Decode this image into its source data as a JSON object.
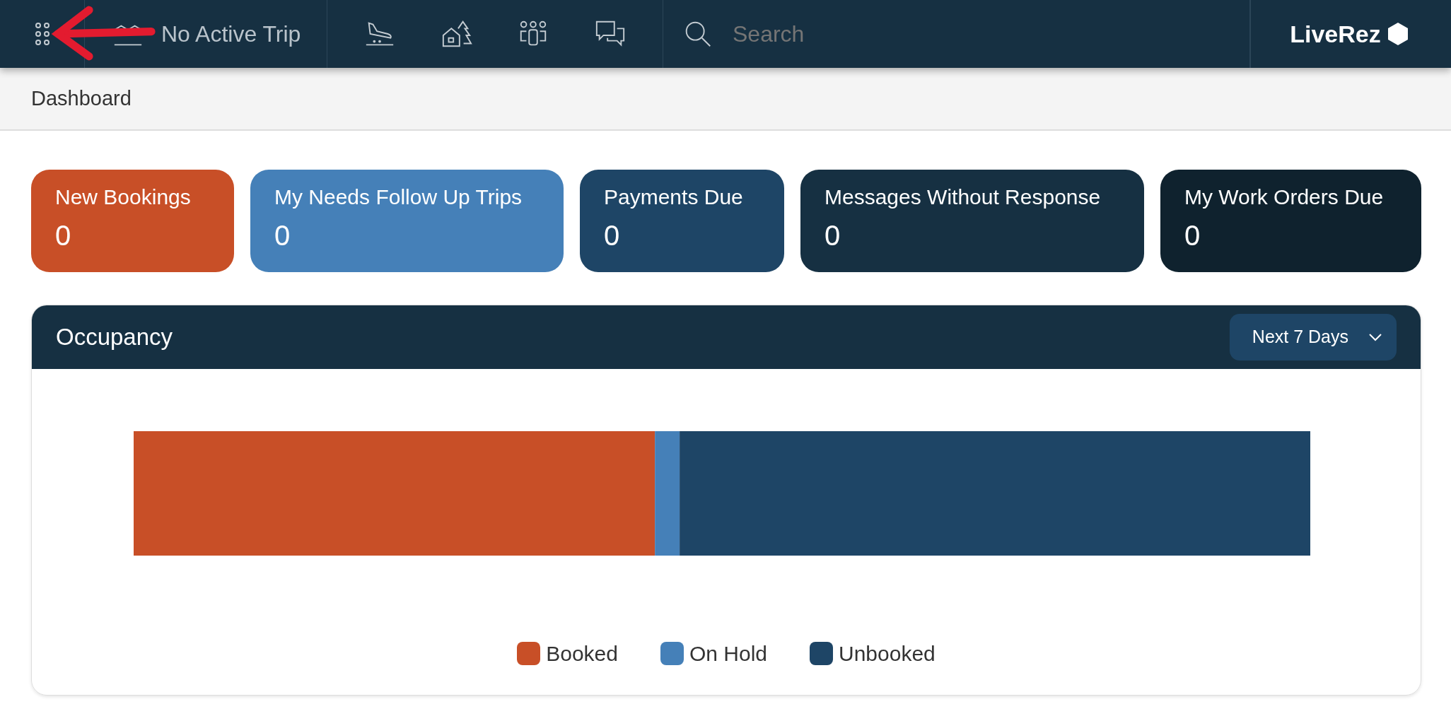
{
  "navbar": {
    "trip": "No Active Trip",
    "search": {
      "placeholder": "Search"
    },
    "logo": "LiveRez"
  },
  "breadcrumb": "Dashboard",
  "stat_cards": [
    {
      "title": "New Bookings",
      "count": "0",
      "color": "#c84f27"
    },
    {
      "title": "My Needs Follow Up Trips",
      "count": "0",
      "color": "#4580b8"
    },
    {
      "title": "Payments Due",
      "count": "0",
      "color": "#1e4566"
    },
    {
      "title": "Messages Without Response",
      "count": "0",
      "color": "#163042"
    },
    {
      "title": "My Work Orders Due",
      "count": "0",
      "color": "#0f222e"
    }
  ],
  "occupancy": {
    "title": "Occupancy",
    "range": "Next 7 Days",
    "legend": [
      {
        "label": "Booked",
        "color": "#c84f27"
      },
      {
        "label": "On Hold",
        "color": "#4580b8"
      },
      {
        "label": "Unbooked",
        "color": "#1e4566"
      }
    ]
  }
}
